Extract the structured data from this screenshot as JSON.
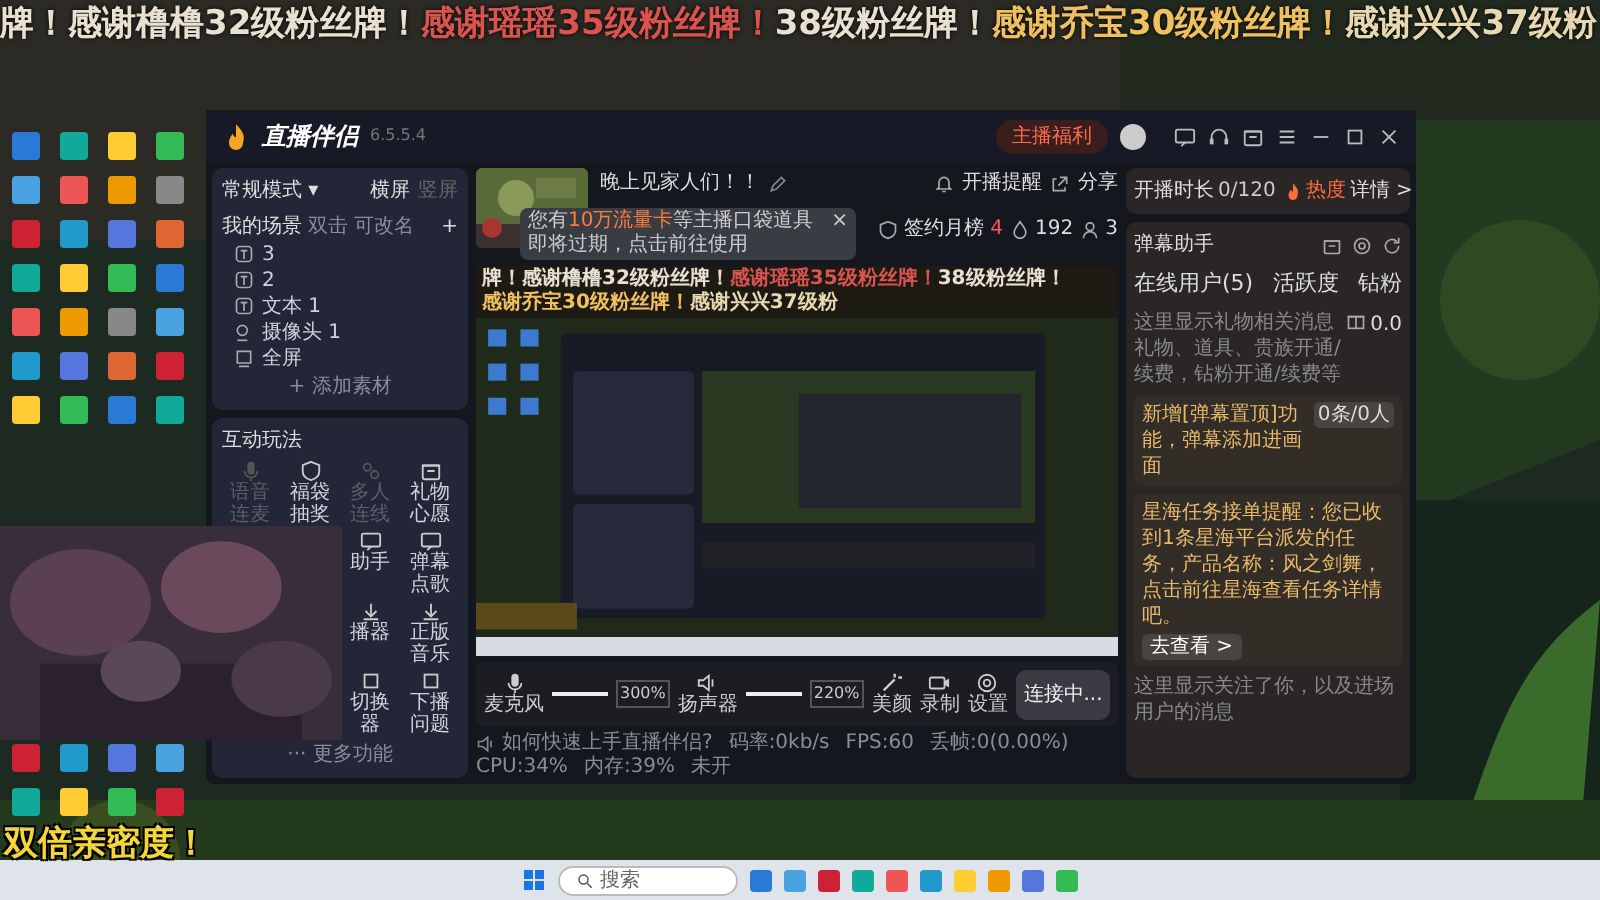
{
  "ticker": [
    {
      "text": "牌！感谢橹橹32级粉丝牌！",
      "color": "#e8e0d0"
    },
    {
      "text": "感谢瑶瑶35级粉丝牌！",
      "color": "#d9534f"
    },
    {
      "text": "38级粉丝牌！",
      "color": "#e8e0d0"
    },
    {
      "text": "感谢乔宝30级粉丝牌！",
      "color": "#f0c060"
    },
    {
      "text": "感谢兴兴37级粉",
      "color": "#e8d8b0"
    }
  ],
  "app": {
    "title": "直播伴侣",
    "version": "6.5.5.4",
    "promo_button": "主播福利"
  },
  "mode": {
    "label": "常规模式 ▾",
    "options": [
      {
        "label": "横屏",
        "selected": true
      },
      {
        "label": "竖屏",
        "selected": false
      }
    ]
  },
  "scenes": {
    "title": "我的场景",
    "hints": [
      "双击",
      "可改名"
    ],
    "add_icon": "+",
    "add": "+ 添加素材",
    "items": [
      {
        "label": "3",
        "kind": "text"
      },
      {
        "label": "2",
        "kind": "text"
      },
      {
        "label": "文本 1",
        "kind": "text"
      },
      {
        "label": "摄像头 1",
        "kind": "camera"
      },
      {
        "label": "全屏",
        "kind": "screen"
      }
    ]
  },
  "interactive": {
    "title": "互动玩法",
    "more": "··· 更多功能",
    "rows": [
      [
        {
          "label": "语音连麦",
          "disabled": true
        },
        {
          "label": "福袋抽奖",
          "disabled": false
        },
        {
          "label": "多人连线",
          "disabled": true
        },
        {
          "label": "礼物心愿",
          "disabled": false
        }
      ],
      [
        {
          "label": "助手",
          "disabled": false
        },
        {
          "label": "弹幕点歌",
          "disabled": false
        }
      ],
      [
        {
          "label": "播器",
          "disabled": false
        },
        {
          "label": "正版音乐",
          "disabled": false
        }
      ],
      [
        {
          "label": "切换器",
          "disabled": false
        },
        {
          "label": "下播问题",
          "disabled": false
        }
      ]
    ]
  },
  "stream": {
    "title": "晚上见家人们！！",
    "reminder": "开播提醒",
    "share": "分享",
    "rank": {
      "label": "签约月榜",
      "value": "4"
    },
    "likes": "192",
    "viewers": "3"
  },
  "tooltip": {
    "before": "您有",
    "highlight": "10万流量卡",
    "after": "等主播口袋道具即将过期，点击前往使用",
    "close": "×"
  },
  "preview": {
    "ticker": [
      {
        "text": "牌！感谢橹橹32级粉丝牌！",
        "color": "#e8e0d0"
      },
      {
        "text": "感谢瑶瑶35级粉丝牌！",
        "color": "#d9534f"
      },
      {
        "text": "38级粉丝牌！",
        "color": "#e8e0d0"
      },
      {
        "text": "感谢乔宝30级粉丝牌！",
        "color": "#f0c060"
      },
      {
        "text": "感谢兴兴37级粉",
        "color": "#e8d8b0"
      }
    ]
  },
  "audio": [
    {
      "label": "麦克风",
      "kind": "mic",
      "level": 1.0,
      "reading": "300%"
    },
    {
      "label": "扬声器",
      "kind": "speaker",
      "level": 1.0,
      "reading": "220%"
    }
  ],
  "tools": [
    {
      "label": "美颜",
      "kind": "beauty"
    },
    {
      "label": "录制",
      "kind": "record"
    },
    {
      "label": "设置",
      "kind": "settings"
    }
  ],
  "connect_button": "连接中...",
  "status": {
    "hint": "如何快速上手直播伴侣?",
    "stats": [
      "码率:0kb/s",
      "FPS:60",
      "丢帧:0(0.00%)",
      "CPU:34%",
      "内存:39%",
      "未开"
    ]
  },
  "duration": {
    "label": "开播时长",
    "value": "0/120",
    "heat": "热度",
    "details": "详情 >"
  },
  "assistant": {
    "title": "弹幕助手",
    "tabs": [
      "在线用户(5)",
      "活跃度",
      "钻粉"
    ],
    "gift_placeholder": "这里显示礼物相关消息礼物、道具、贵族开通/续费，钻粉开通/续费等",
    "gift_value": "0.0",
    "notices": [
      {
        "text": "新增[弹幕置顶]功能，弹幕添加进画面",
        "badge": "0条/0人"
      },
      {
        "text": "星海任务接单提醒：您已收到1条星海平台派发的任务，产品名称：风之剑舞，点击前往星海查看任务详情吧。",
        "action": "去查看 >"
      }
    ],
    "follow_placeholder": "这里显示关注了你，以及进场用户的消息"
  },
  "overlay_text": "双倍亲密度！",
  "taskbar": {
    "search": "搜索"
  }
}
